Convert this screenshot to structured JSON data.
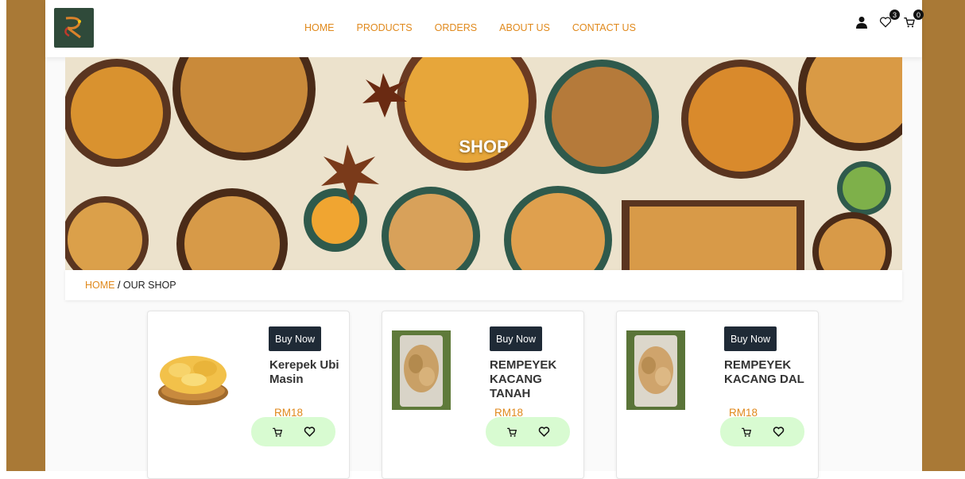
{
  "header": {
    "nav": [
      "HOME",
      "PRODUCTS",
      "ORDERS",
      "ABOUT US",
      "CONTACT US"
    ],
    "wishlist_count": "3",
    "cart_count": "0",
    "icons": [
      "user-icon",
      "heart-icon",
      "cart-icon"
    ]
  },
  "hero": {
    "title": "SHOP"
  },
  "breadcrumb": {
    "home": "HOME",
    "separator": " / ",
    "current": "OUR SHOP"
  },
  "products": [
    {
      "buy_label": "Buy Now",
      "name": "Kerepek Ubi Masin",
      "price": "RM18"
    },
    {
      "buy_label": "Buy Now",
      "name": "REMPEYEK KACANG TANAH",
      "price": "RM18"
    },
    {
      "buy_label": "Buy Now",
      "name": "REMPEYEK KACANG DAL",
      "price": "RM18"
    }
  ],
  "colors": {
    "accent": "#e0891c",
    "frame": "#a97936",
    "button": "#1f2a36",
    "action_bg": "#d8fbd1"
  }
}
